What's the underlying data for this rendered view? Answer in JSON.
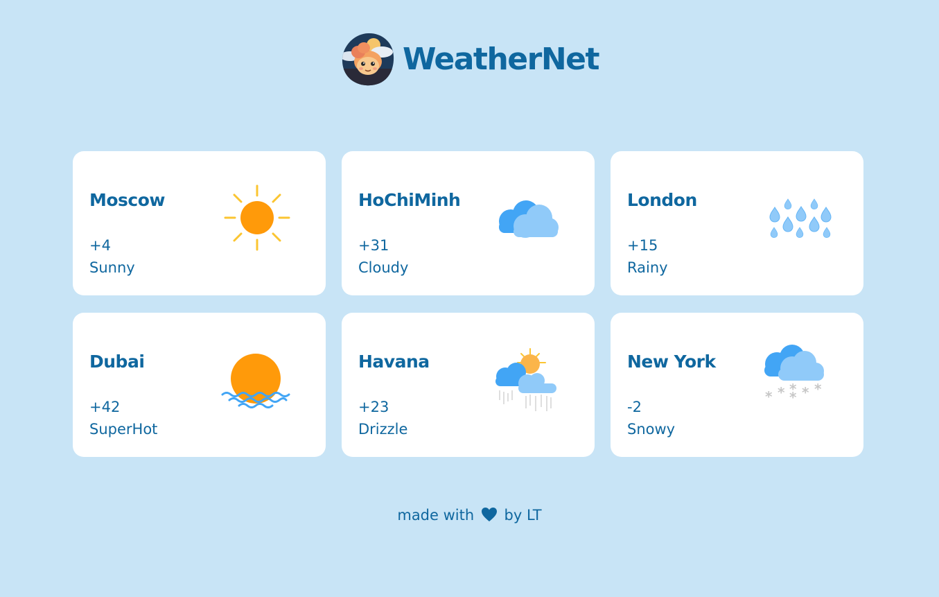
{
  "app": {
    "title": "WeatherNet",
    "logo_icon": "mascot-logo-icon"
  },
  "cities": [
    {
      "name": "Moscow",
      "temp": "+4",
      "condition": "Sunny",
      "icon": "sun-icon"
    },
    {
      "name": "HoChiMinh",
      "temp": "+31",
      "condition": "Cloudy",
      "icon": "cloud-icon"
    },
    {
      "name": "London",
      "temp": "+15",
      "condition": "Rainy",
      "icon": "raindrops-icon"
    },
    {
      "name": "Dubai",
      "temp": "+42",
      "condition": "SuperHot",
      "icon": "sunset-icon"
    },
    {
      "name": "Havana",
      "temp": "+23",
      "condition": "Drizzle",
      "icon": "sun-cloud-drizzle-icon"
    },
    {
      "name": "New York",
      "temp": "-2",
      "condition": "Snowy",
      "icon": "cloud-snow-icon"
    }
  ],
  "footer": {
    "prefix": "made with",
    "suffix": "by LT",
    "heart_icon": "heart-icon"
  },
  "colors": {
    "background": "#c8e4f6",
    "card": "#ffffff",
    "text": "#0f679f",
    "sun": "#ff9a0a",
    "sun_rays": "#fbc531",
    "cloud_dark": "#42a5f5",
    "cloud_light": "#90caf9",
    "snow": "#c7c7c7"
  }
}
